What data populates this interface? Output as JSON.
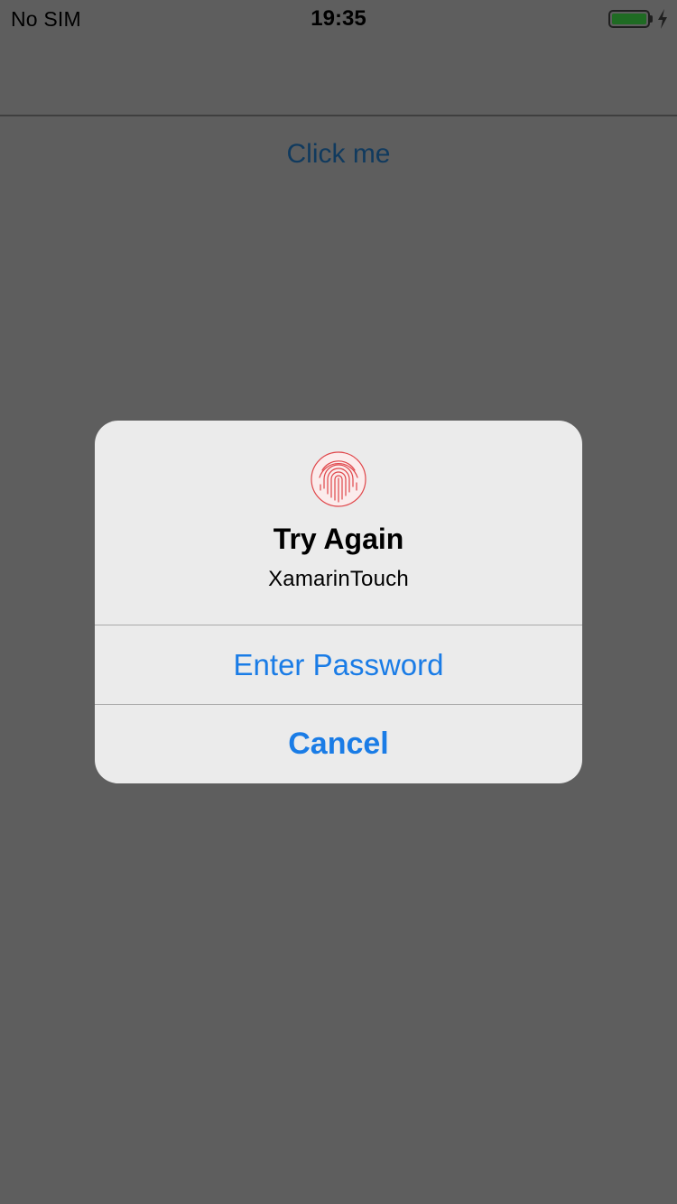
{
  "status_bar": {
    "carrier": "No SIM",
    "time": "19:35",
    "battery_level": 1.0,
    "charging": true,
    "battery_color": "#1f6b23"
  },
  "main": {
    "click_me_label": "Click me",
    "link_color": "#103a5e"
  },
  "alert": {
    "icon": "fingerprint-icon",
    "icon_color": "#e0464a",
    "title": "Try Again",
    "message": "XamarinTouch",
    "buttons": [
      {
        "label": "Enter Password"
      },
      {
        "label": "Cancel"
      }
    ],
    "button_color": "#1a7ce6"
  },
  "colors": {
    "dimmed_background": "#5e5e5e",
    "alert_background": "#ebebeb"
  }
}
